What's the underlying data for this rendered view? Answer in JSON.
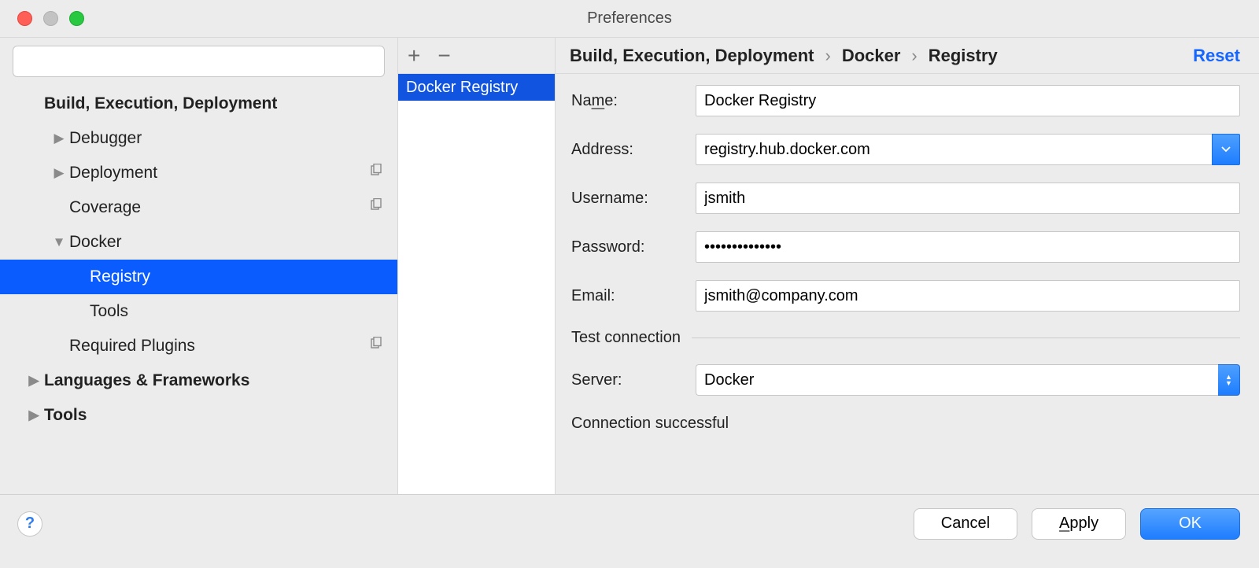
{
  "window": {
    "title": "Preferences"
  },
  "sidebar": {
    "search_placeholder": "",
    "items": [
      {
        "label": "Build, Execution, Deployment",
        "bold": true,
        "caret": "",
        "indent": 0
      },
      {
        "label": "Debugger",
        "bold": false,
        "caret": "right",
        "indent": 1
      },
      {
        "label": "Deployment",
        "bold": false,
        "caret": "right",
        "indent": 1,
        "copy": true
      },
      {
        "label": "Coverage",
        "bold": false,
        "caret": "",
        "indent": 1,
        "copy": true
      },
      {
        "label": "Docker",
        "bold": false,
        "caret": "down",
        "indent": 1
      },
      {
        "label": "Registry",
        "bold": false,
        "caret": "",
        "indent": 3,
        "selected": true
      },
      {
        "label": "Tools",
        "bold": false,
        "caret": "",
        "indent": 3
      },
      {
        "label": "Required Plugins",
        "bold": false,
        "caret": "",
        "indent": 1,
        "copy": true
      },
      {
        "label": "Languages & Frameworks",
        "bold": true,
        "caret": "right",
        "indent": 0
      },
      {
        "label": "Tools",
        "bold": true,
        "caret": "right",
        "indent": 0
      }
    ]
  },
  "mid": {
    "items": [
      {
        "label": "Docker Registry"
      }
    ]
  },
  "breadcrumb": {
    "parts": [
      "Build, Execution, Deployment",
      "Docker",
      "Registry"
    ],
    "reset": "Reset"
  },
  "form": {
    "name_label": "Name:",
    "name_value": "Docker Registry",
    "address_label": "Address:",
    "address_value": "registry.hub.docker.com",
    "username_label": "Username:",
    "username_value": "jsmith",
    "password_label": "Password:",
    "password_value": "••••••••••••••",
    "email_label": "Email:",
    "email_value": "jsmith@company.com",
    "test_section": "Test connection",
    "server_label": "Server:",
    "server_value": "Docker",
    "status": "Connection successful"
  },
  "footer": {
    "cancel": "Cancel",
    "apply": "Apply",
    "ok": "OK"
  }
}
